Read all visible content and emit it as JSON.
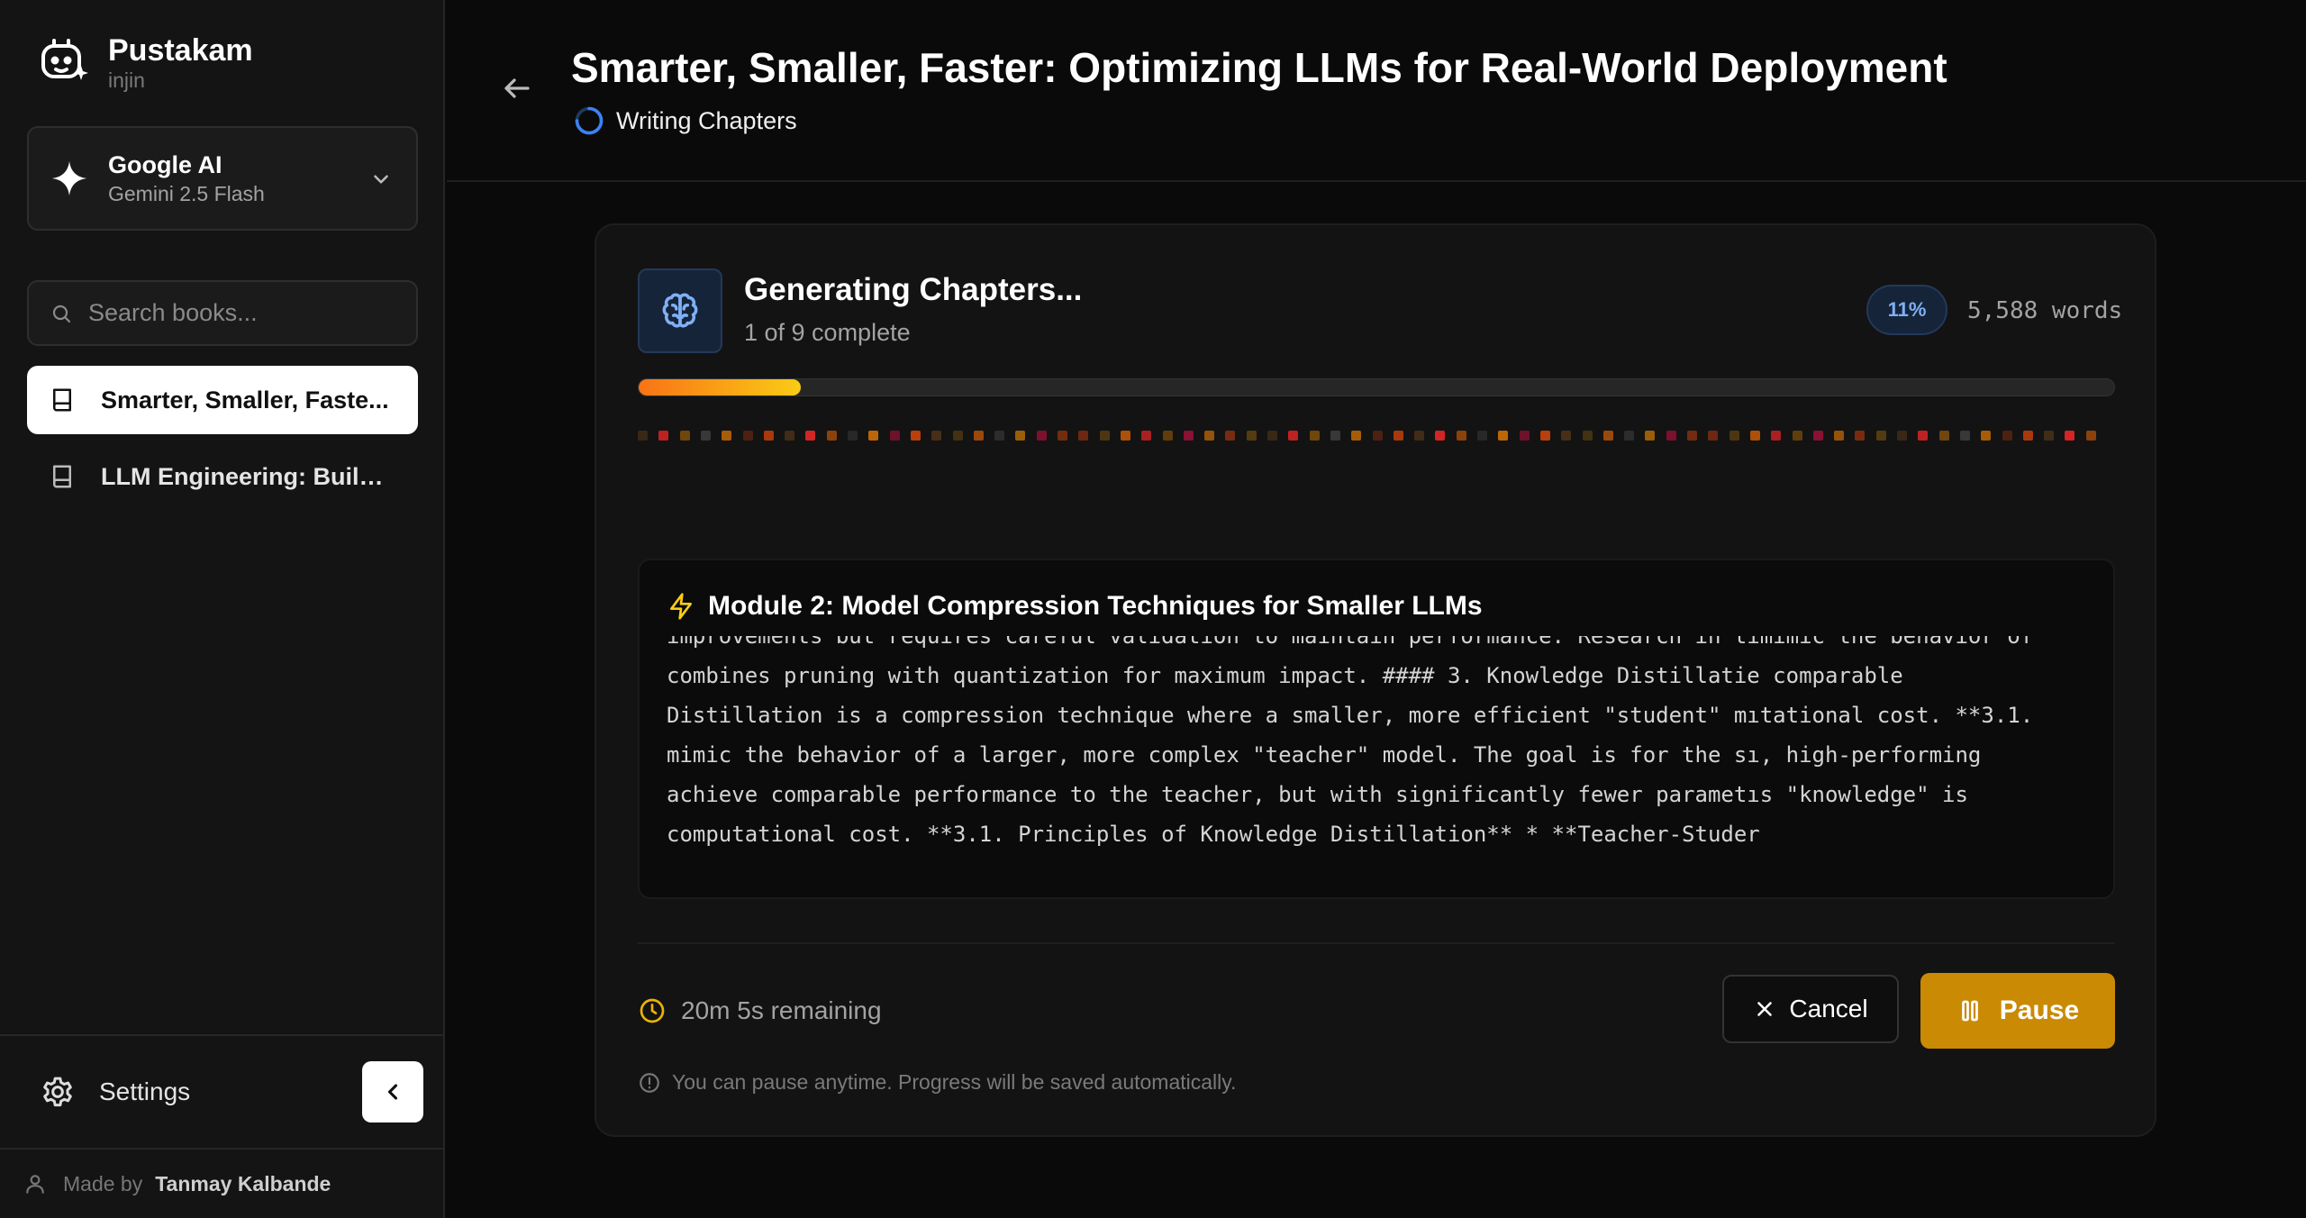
{
  "app": {
    "name": "Pustakam",
    "user": "injin"
  },
  "model": {
    "provider": "Google AI",
    "name": "Gemini 2.5 Flash",
    "icon": "sparkle-icon"
  },
  "search": {
    "placeholder": "Search books..."
  },
  "books": [
    {
      "title": "Smarter, Smaller, Faste...",
      "active": true
    },
    {
      "title": "LLM Engineering: Buildi...",
      "active": false
    }
  ],
  "footer": {
    "settings_label": "Settings",
    "made_by_prefix": "Made by",
    "author": "Tanmay Kalbande"
  },
  "header": {
    "title": "Smarter, Smaller, Faster: Optimizing LLMs for Real-World Deployment",
    "status": "Writing Chapters"
  },
  "generation": {
    "title": "Generating Chapters...",
    "progress_text": "1 of 9 complete",
    "percent_label": "11%",
    "progress_fraction": 0.11,
    "words": "5,588 words",
    "module_title": "Module 2: Model Compression Techniques for Smaller LLMs",
    "stream_lines": [
      "improvements but requires careful validation to maintain performance. Research in tımimic the behavior of",
      "combines pruning with quantization for maximum impact. #### 3. Knowledge Distillatie comparable",
      "Distillation is a compression technique where a smaller, more efficient \"student\" mıtational cost. **3.1.",
      "mimic the behavior of a larger, more complex \"teacher\" model. The goal is for the sı, high-performing",
      "achieve comparable performance to the teacher, but with significantly fewer parametıs \"knowledge\" is",
      "computational cost. **3.1. Principles of Knowledge Distillation** * **Teacher-Studer"
    ],
    "remaining": "20m 5s remaining",
    "cancel_label": "Cancel",
    "pause_label": "Pause",
    "note": "You can pause anytime. Progress will be saved automatically."
  },
  "colors": {
    "accent": "#ca8a04",
    "progress_start": "#f97316",
    "progress_end": "#facc15",
    "badge_text": "#7fb0f5"
  }
}
